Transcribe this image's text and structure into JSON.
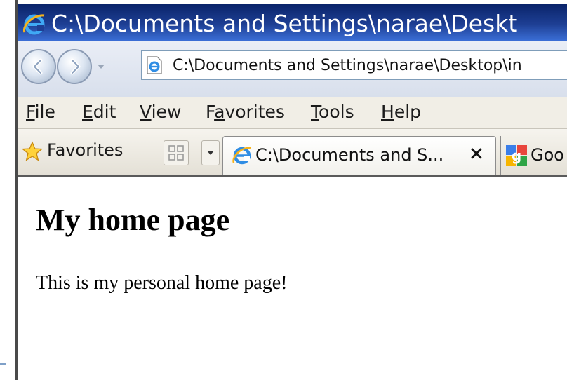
{
  "window": {
    "title": "C:\\Documents and Settings\\narae\\Deskt"
  },
  "navigation": {
    "address": "C:\\Documents and Settings\\narae\\Desktop\\in"
  },
  "menu": {
    "items": [
      {
        "label": "File",
        "accesskey": "F",
        "rest": "ile"
      },
      {
        "label": "Edit",
        "accesskey": "E",
        "rest": "dit"
      },
      {
        "label": "View",
        "accesskey": "V",
        "rest": "iew"
      },
      {
        "label": "Favorites",
        "prefix": "F",
        "accesskey": "a",
        "rest": "vorites"
      },
      {
        "label": "Tools",
        "accesskey": "T",
        "rest": "ools"
      },
      {
        "label": "Help",
        "accesskey": "H",
        "rest": "elp"
      }
    ]
  },
  "toolbar": {
    "favorites_label": "Favorites"
  },
  "tabs": {
    "active_label": "C:\\Documents and S...",
    "close_glyph": "×",
    "google_label": "Goo"
  },
  "page": {
    "heading": "My home page",
    "paragraph": "This is my personal home page!"
  },
  "icons": {
    "browser": "internet-explorer-icon",
    "back": "back-arrow-icon",
    "forward": "forward-arrow-icon",
    "favorites": "star-icon",
    "quick_tabs": "quick-tabs-icon",
    "tab_list": "chevron-down-icon",
    "google": "google-icon"
  },
  "colors": {
    "titlebar": "#0a246a",
    "menubar": "#f1eee6",
    "address_border": "#7f9db9"
  }
}
